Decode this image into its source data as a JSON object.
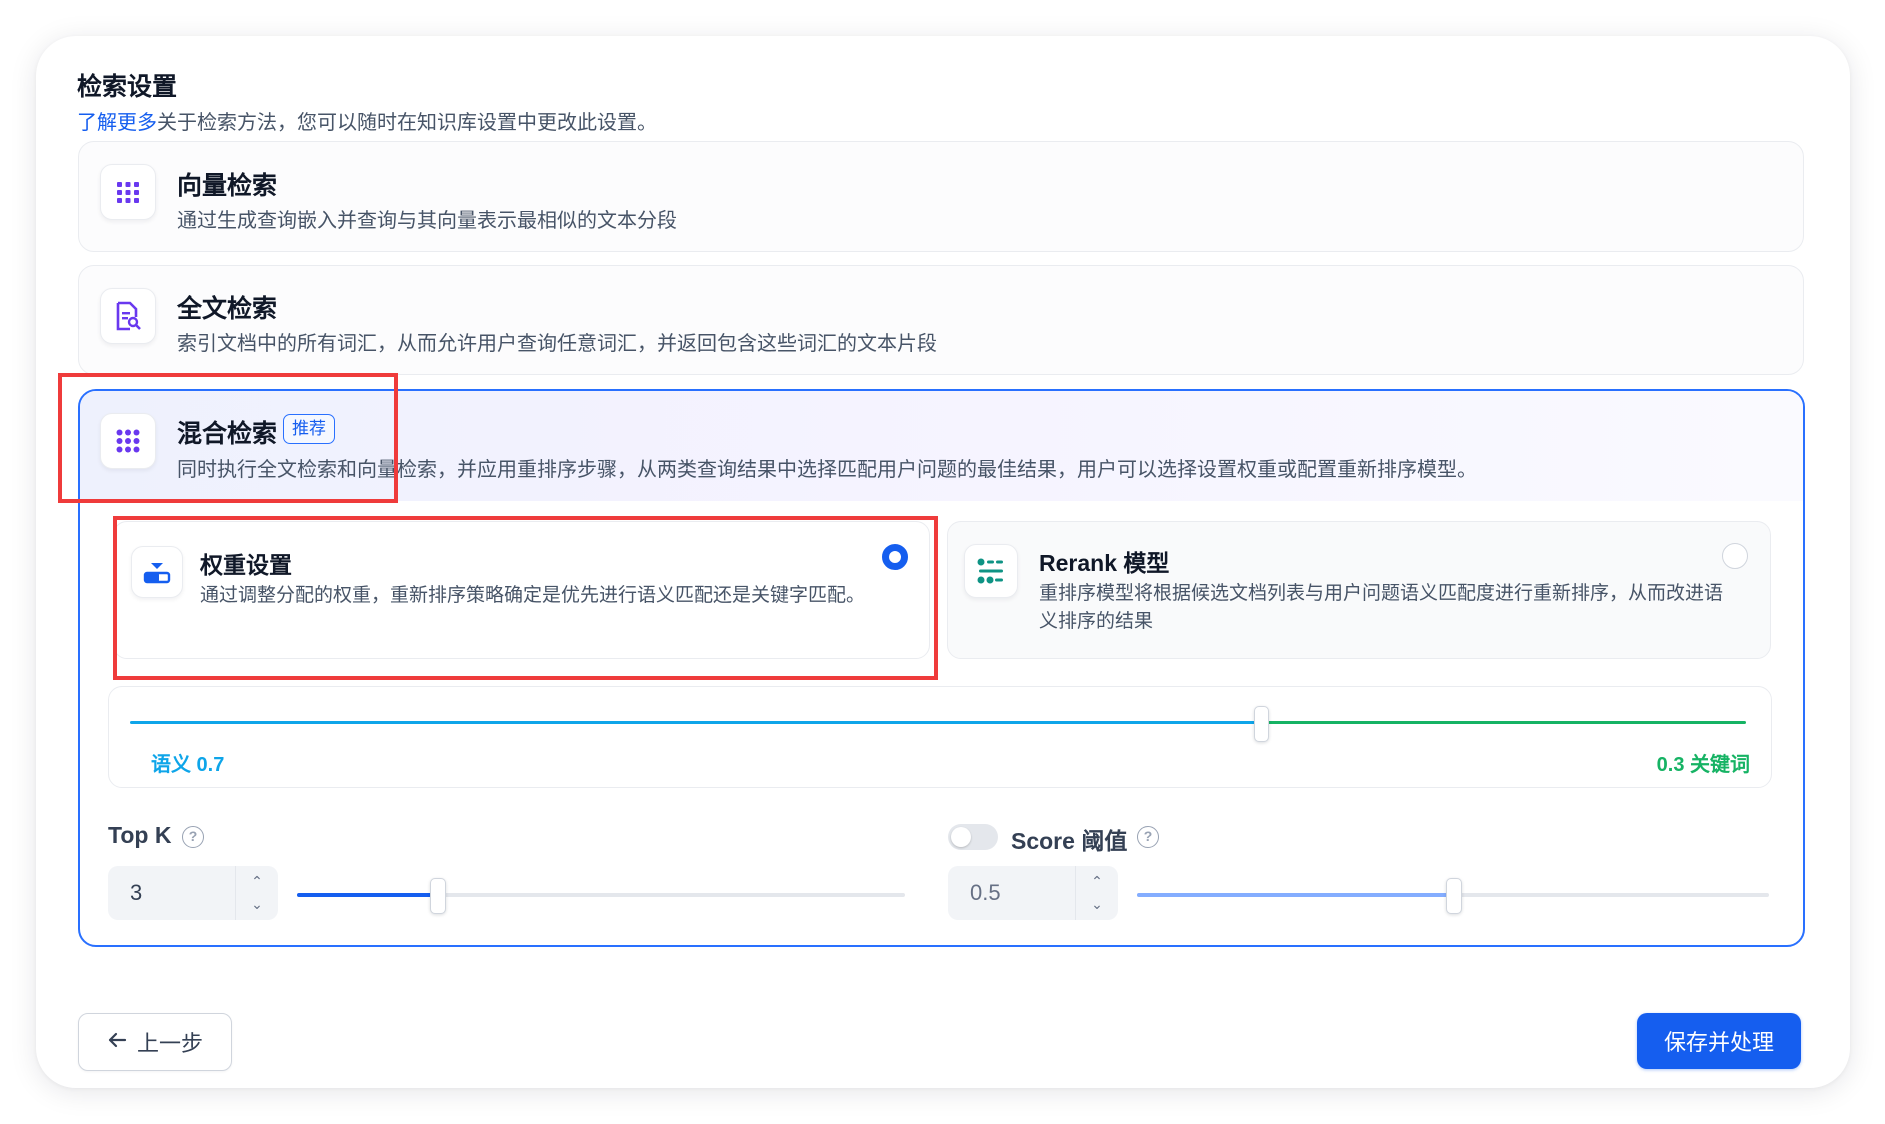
{
  "header": {
    "title": "检索设置",
    "link_text": "了解更多",
    "subtitle_rest": "关于检索方法，您可以随时在知识库设置中更改此设置。"
  },
  "methods": [
    {
      "title": "向量检索",
      "desc": "通过生成查询嵌入并查询与其向量表示最相似的文本分段",
      "icon": "vector-grid-icon"
    },
    {
      "title": "全文检索",
      "desc": "索引文档中的所有词汇，从而允许用户查询任意词汇，并返回包含这些词汇的文本片段",
      "icon": "doc-search-icon"
    },
    {
      "title": "混合检索",
      "badge": "推荐",
      "desc": "同时执行全文检索和向量检索，并应用重排序步骤，从两类查询结果中选择匹配用户问题的最佳结果，用户可以选择设置权重或配置重新排序模型。",
      "icon": "dots-grid-icon",
      "selected": true
    }
  ],
  "rerank_modes": [
    {
      "title": "权重设置",
      "desc": "通过调整分配的权重，重新排序策略确定是优先进行语义匹配还是关键字匹配。",
      "selected": true,
      "icon": "weight-slider-icon"
    },
    {
      "title": "Rerank 模型",
      "desc": "重排序模型将根据候选文档列表与用户问题语义匹配度进行重新排序，从而改进语义排序的结果",
      "selected": false,
      "icon": "rerank-icon"
    }
  ],
  "weights": {
    "semantic_label": "语义 0.7",
    "keyword_label": "0.3 关键词",
    "semantic_value": 0.7,
    "keyword_value": 0.3,
    "semantic_color": "#0ea5e9",
    "keyword_color": "#16b364"
  },
  "top_k": {
    "label": "Top K",
    "value": "3",
    "slider_fraction": 0.23
  },
  "score": {
    "label": "Score 阈值",
    "value": "0.5",
    "enabled": false,
    "slider_fraction": 0.5
  },
  "footer": {
    "back_label": "上一步",
    "save_label": "保存并处理"
  },
  "colors": {
    "primary": "#155eef",
    "icon_purple": "#6938ef",
    "highlight_red": "#ef3b3b"
  }
}
